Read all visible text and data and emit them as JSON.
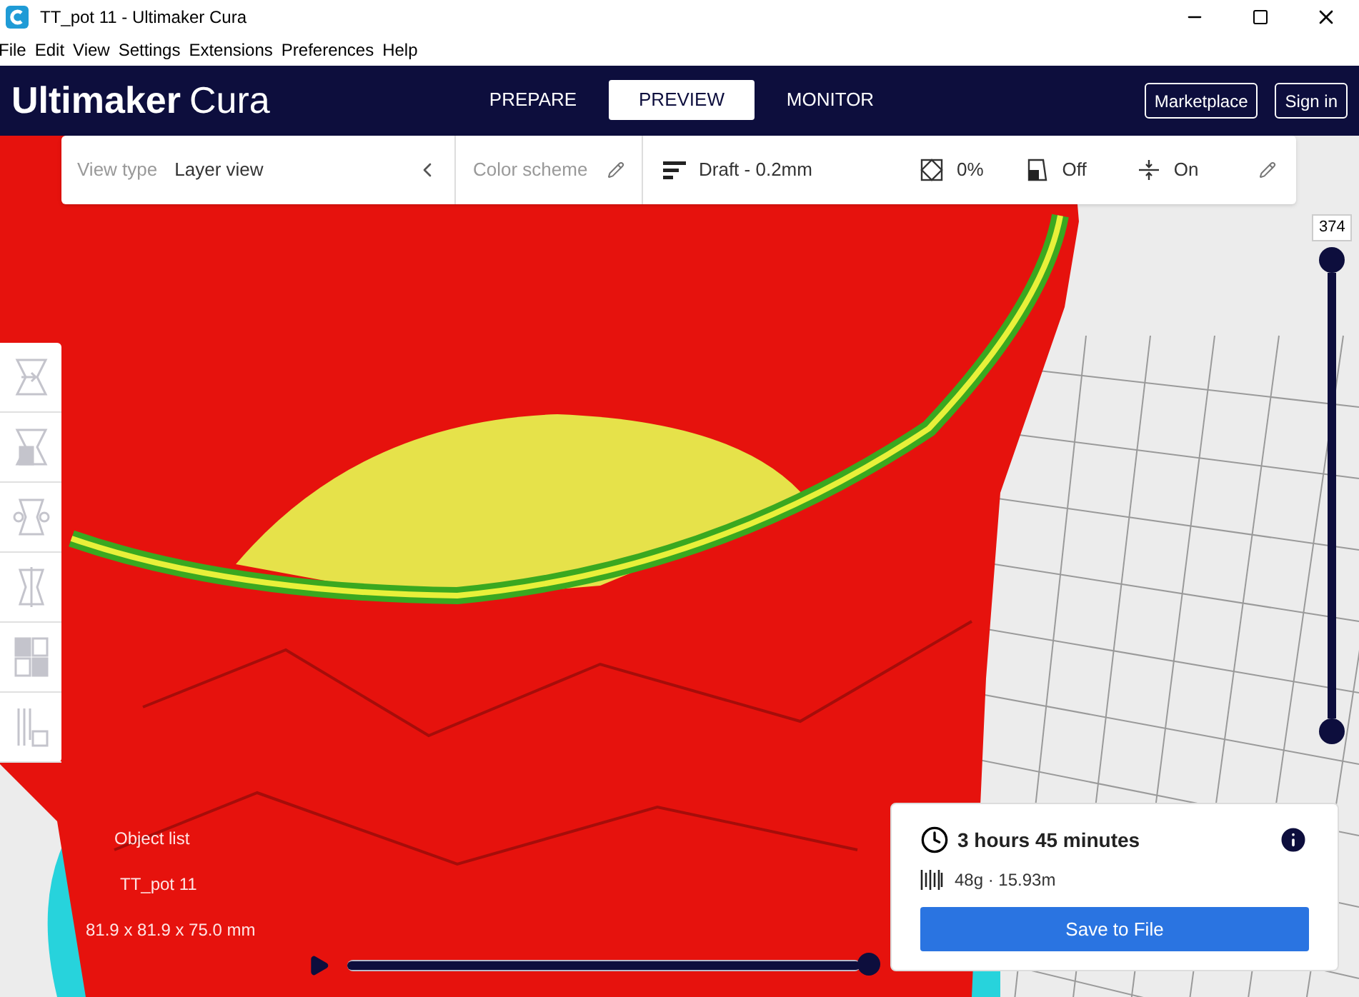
{
  "window": {
    "title": "TT_pot 11 - Ultimaker Cura"
  },
  "menu": [
    "File",
    "Edit",
    "View",
    "Settings",
    "Extensions",
    "Preferences",
    "Help"
  ],
  "header": {
    "brand": "Ultimaker",
    "product": "Cura",
    "stages": [
      {
        "label": "PREPARE",
        "selected": false
      },
      {
        "label": "PREVIEW",
        "selected": true
      },
      {
        "label": "MONITOR",
        "selected": false
      }
    ],
    "buttons": [
      "Marketplace",
      "Sign in"
    ]
  },
  "toolbar": {
    "view_type_label": "View type",
    "view_type_value": "Layer view",
    "color_scheme_label": "Color scheme",
    "profile": "Draft - 0.2mm",
    "infill": "0%",
    "support": "Off",
    "adhesion": "On"
  },
  "layer_slider": {
    "label": "374",
    "level": 1
  },
  "path_slider": {
    "level": 1
  },
  "object_list": {
    "title": "Object list",
    "name": "TT_pot 11",
    "dimensions": "81.9 x 81.9 x 75.0 mm"
  },
  "print_panel": {
    "time": "3 hours 45 minutes",
    "material": "48g · 15.93m",
    "button": "Save to File"
  }
}
